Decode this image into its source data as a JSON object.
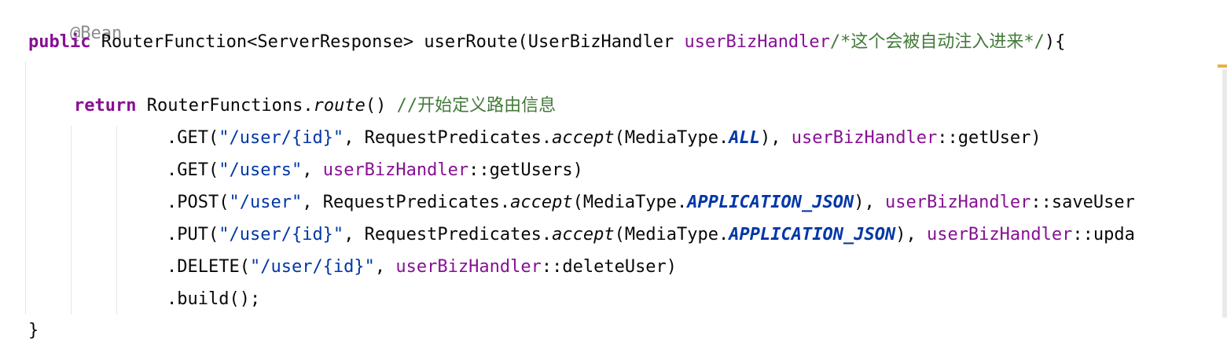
{
  "code": {
    "annotation": "@Bean",
    "line1": {
      "kw": "public",
      "type": "RouterFunction<ServerResponse>",
      "method": "userRoute(UserBizHandler",
      "param": "userBizHandler",
      "comment": "/*这个会被自动注入进来*/",
      "end": "){"
    },
    "line3": {
      "kw": "return",
      "cls": "RouterFunctions.",
      "method": "route",
      "parens": "()",
      "comment": "//开始定义路由信息"
    },
    "line4": {
      "a": ".GET(",
      "s": "\"/user/{id}\"",
      "b": ", RequestPredicates.",
      "m": "accept",
      "c": "(MediaType.",
      "k": "ALL",
      "d": "), ",
      "p": "userBizHandler",
      "e": "::getUser)"
    },
    "line5": {
      "a": ".GET(",
      "s": "\"/users\"",
      "b": ", ",
      "p": "userBizHandler",
      "e": "::getUsers)"
    },
    "line6": {
      "a": ".POST(",
      "s": "\"/user\"",
      "b": ", RequestPredicates.",
      "m": "accept",
      "c": "(MediaType.",
      "k": "APPLICATION_JSON",
      "d": "), ",
      "p": "userBizHandler",
      "e": "::saveUser"
    },
    "line7": {
      "a": ".PUT(",
      "s": "\"/user/{id}\"",
      "b": ", RequestPredicates.",
      "m": "accept",
      "c": "(MediaType.",
      "k": "APPLICATION_JSON",
      "d": "), ",
      "p": "userBizHandler",
      "e": "::upda"
    },
    "line8": {
      "a": ".DELETE(",
      "s": "\"/user/{id}\"",
      "b": ", ",
      "p": "userBizHandler",
      "e": "::deleteUser)"
    },
    "line9": ".build();",
    "line10": "}"
  },
  "colors": {
    "keyword": "#871094",
    "string": "#0037a6",
    "comment": "#437a3a",
    "constant": "#0037a6"
  }
}
